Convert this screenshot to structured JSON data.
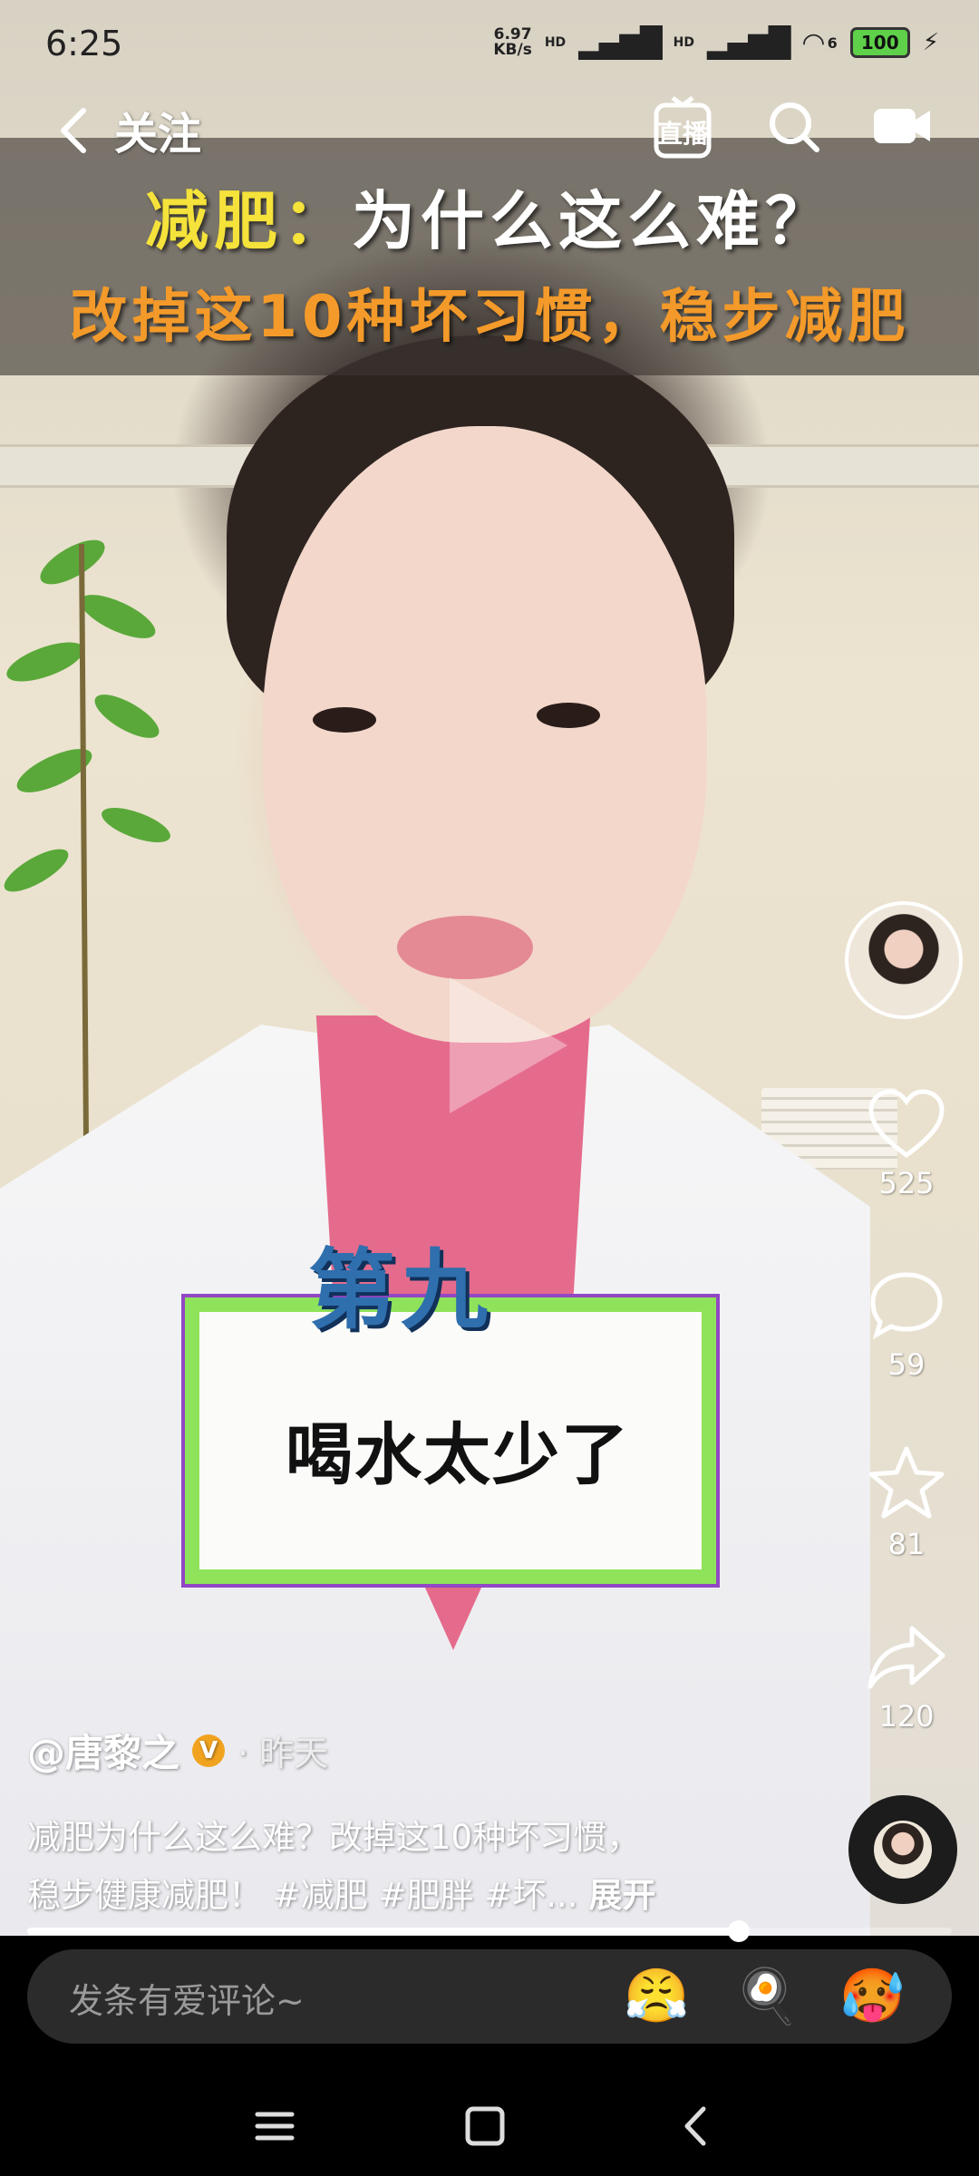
{
  "status_bar": {
    "time": "6:25",
    "net_speed_value": "6.97",
    "net_speed_unit": "KB/s",
    "signal1": "HD",
    "signal2": "HD",
    "wifi_badge": "6",
    "battery": "100"
  },
  "top_nav": {
    "follow_label": "关注",
    "live_label": "直播"
  },
  "video_overlay": {
    "title_highlight": "减肥：",
    "title_rest": "为什么这么难？",
    "subtitle": "改掉这10种坏习惯，稳步减肥",
    "caption_badge": "第九",
    "caption_text": "喝水太少了"
  },
  "actions": {
    "like_count": "525",
    "comment_count": "59",
    "favorite_count": "81",
    "share_count": "120"
  },
  "post": {
    "author": "@唐黎之",
    "verified_badge": "V",
    "time": "· 昨天",
    "description_line1": "减肥为什么这么难？改掉这10种坏习惯，",
    "description_line2": "稳步健康减肥！ #减肥 #肥胖 #坏...",
    "expand_label": "展开"
  },
  "progress_fraction": 0.77,
  "comment_bar": {
    "placeholder": "发条有爱评论~",
    "emojis": [
      "😤",
      "🍳",
      "🥵"
    ]
  },
  "icons": [
    "back-icon",
    "live-icon",
    "search-icon",
    "camera-icon",
    "play-icon",
    "heart-icon",
    "comment-icon",
    "star-icon",
    "share-icon",
    "menu-icon",
    "home-icon",
    "nav-back-icon"
  ]
}
